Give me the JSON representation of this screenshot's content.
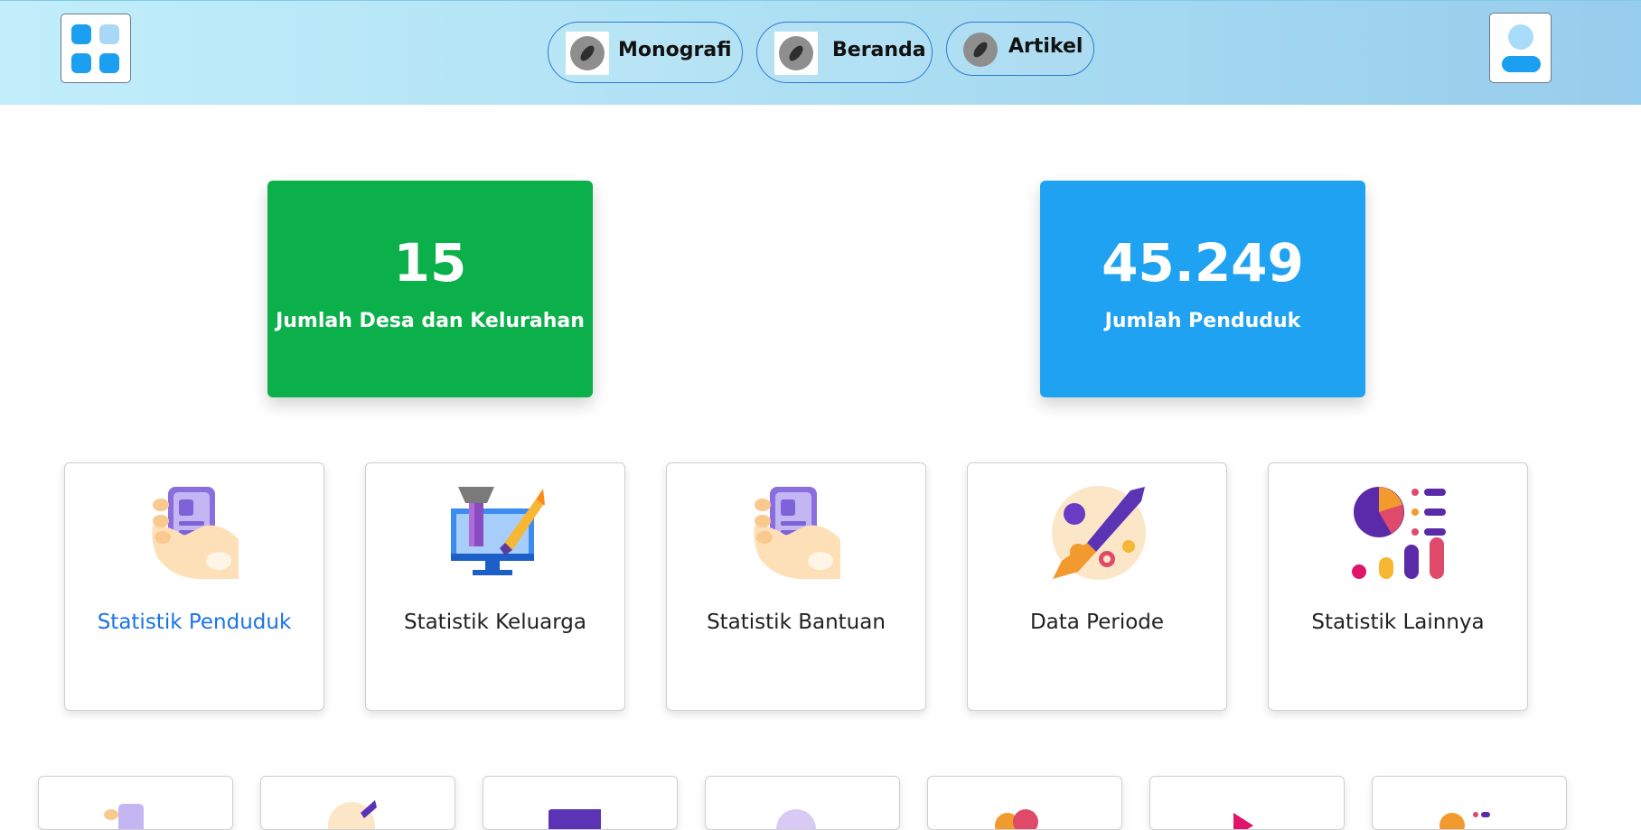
{
  "header": {
    "nav": [
      {
        "label": "Monografi",
        "icon": "compass-icon"
      },
      {
        "label": "Beranda",
        "icon": "compass-icon"
      },
      {
        "label": "Artikel",
        "icon": "compass-icon"
      }
    ],
    "colors": {
      "accent": "#1b9ff0",
      "border": "#2b7bd0"
    }
  },
  "stats": [
    {
      "value": "15",
      "caption": "Jumlah Desa dan Kelurahan",
      "color": "#0bb04b"
    },
    {
      "value": "45.249",
      "caption": "Jumlah Penduduk",
      "color": "#1ea2f1"
    }
  ],
  "menu": [
    {
      "label": "Statistik Penduduk",
      "icon": "phone-hand-icon",
      "active": true
    },
    {
      "label": "Statistik Keluarga",
      "icon": "monitor-brush-icon",
      "active": false
    },
    {
      "label": "Statistik Bantuan",
      "icon": "phone-hand-icon",
      "active": false
    },
    {
      "label": "Data Periode",
      "icon": "palette-brush-icon",
      "active": false
    },
    {
      "label": "Statistik Lainnya",
      "icon": "charts-icon",
      "active": false
    }
  ],
  "active_color": "#1a73e8"
}
